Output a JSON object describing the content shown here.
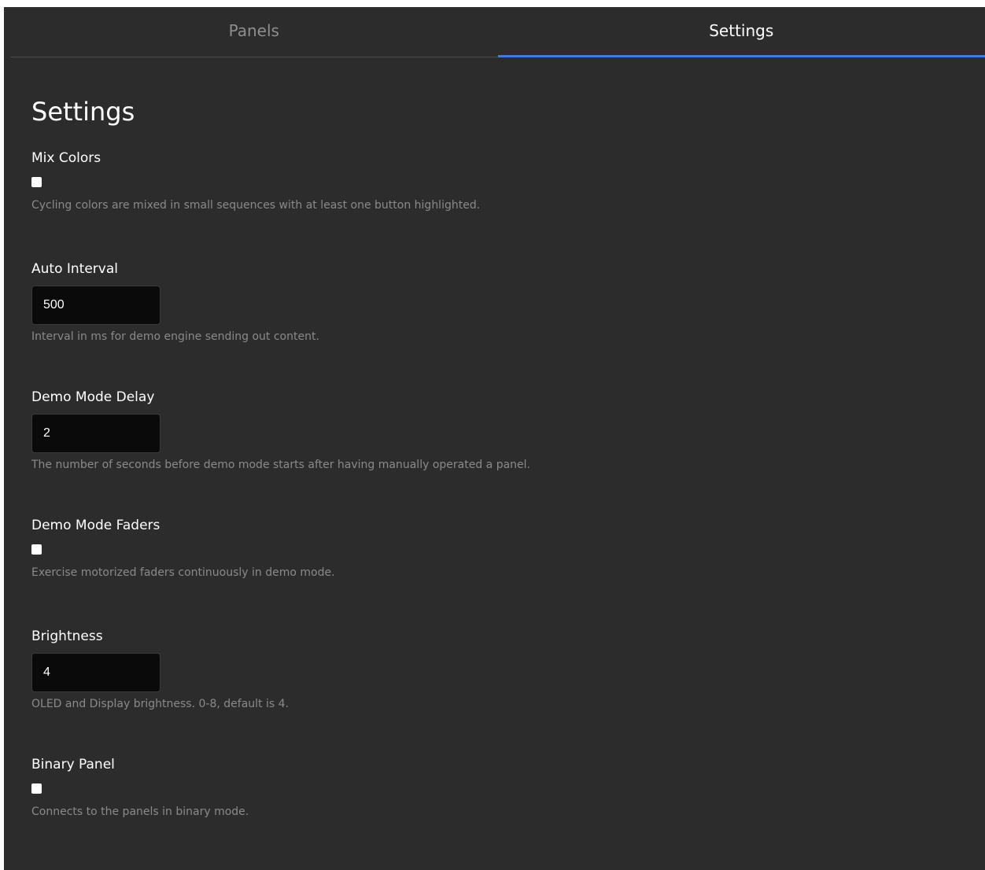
{
  "tabs": [
    {
      "label": "Panels",
      "active": false
    },
    {
      "label": "Settings",
      "active": true
    }
  ],
  "page": {
    "title": "Settings"
  },
  "settings": {
    "mix_colors": {
      "label": "Mix Colors",
      "type": "checkbox",
      "checked": false,
      "help": "Cycling colors are mixed in small sequences with at least one button highlighted."
    },
    "auto_interval": {
      "label": "Auto Interval",
      "type": "number",
      "value": "500",
      "help": "Interval in ms for demo engine sending out content."
    },
    "demo_mode_delay": {
      "label": "Demo Mode Delay",
      "type": "number",
      "value": "2",
      "help": "The number of seconds before demo mode starts after having manually operated a panel."
    },
    "demo_mode_faders": {
      "label": "Demo Mode Faders",
      "type": "checkbox",
      "checked": false,
      "help": "Exercise motorized faders continuously in demo mode."
    },
    "brightness": {
      "label": "Brightness",
      "type": "number",
      "value": "4",
      "help": "OLED and Display brightness. 0-8, default is 4."
    },
    "binary_panel": {
      "label": "Binary Panel",
      "type": "checkbox",
      "checked": false,
      "help": "Connects to the panels in binary mode."
    }
  },
  "colors": {
    "background": "#2c2c2c",
    "accent": "#3b7de0",
    "input_background": "#0a0a0a",
    "help_text": "#8a8a8a"
  }
}
